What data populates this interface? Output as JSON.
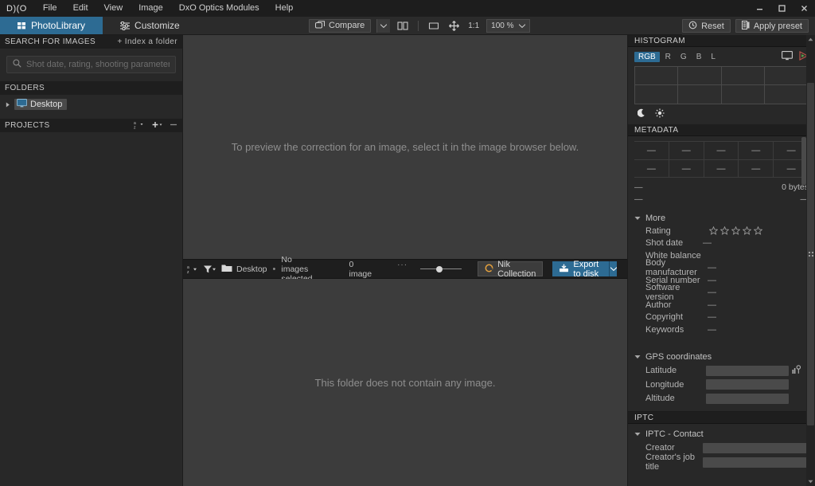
{
  "app": {
    "logo": "D)(O",
    "menus": [
      "File",
      "Edit",
      "View",
      "Image",
      "DxO Optics Modules",
      "Help"
    ],
    "window_controls": [
      "minimize",
      "maximize",
      "close"
    ],
    "accent_color": "#2d6b93"
  },
  "tabs": [
    {
      "label": "PhotoLibrary",
      "icon": "grid-icon",
      "active": true
    },
    {
      "label": "Customize",
      "icon": "sliders-icon",
      "active": false
    }
  ],
  "toolbar": {
    "compare_label": "Compare",
    "compare_icon": "compare-icon",
    "split_view_icon": "split-view-icon",
    "fit_icon": "fit-to-screen-icon",
    "pan_icon": "pan-icon",
    "ratio_label": "1:1",
    "zoom_value": "100 %",
    "reset_label": "Reset",
    "reset_icon": "history-icon",
    "apply_preset_label": "Apply preset",
    "apply_preset_icon": "preset-icon"
  },
  "sidebar": {
    "search": {
      "title": "SEARCH FOR IMAGES",
      "action": "+ Index a folder",
      "placeholder": "Shot date, rating, shooting parameters...",
      "value": ""
    },
    "folders": {
      "title": "FOLDERS",
      "items": [
        {
          "label": "Desktop",
          "selected": true
        }
      ]
    },
    "projects": {
      "title": "PROJECTS",
      "icons": [
        "sort-az-icon",
        "add-icon",
        "remove-icon"
      ]
    }
  },
  "viewer": {
    "message": "To preview the correction for an image, select it in the image browser below."
  },
  "browser_bar": {
    "sort_icon": "sort-az-icon",
    "filter_icon": "filter-icon",
    "folder_icon": "folder-icon",
    "folder_name": "Desktop",
    "separator": "•",
    "selection_status": "No images selected",
    "image_count": "0 image",
    "overflow": "···",
    "nik_label": "Nik Collection",
    "nik_icon": "nik-icon",
    "export_label": "Export to disk",
    "export_icon": "export-icon",
    "expand_icon": "chevron-right-icon"
  },
  "filmstrip": {
    "message": "This folder does not contain any image."
  },
  "histogram": {
    "title": "HISTOGRAM",
    "channels": [
      {
        "label": "RGB",
        "active": true
      },
      {
        "label": "R",
        "active": false
      },
      {
        "label": "G",
        "active": false
      },
      {
        "label": "B",
        "active": false
      },
      {
        "label": "L",
        "active": false
      }
    ],
    "right_icons": [
      "monitor-icon",
      "gamut-icon"
    ],
    "footer_icons": [
      "moon-icon",
      "sun-icon"
    ]
  },
  "metadata": {
    "title": "METADATA",
    "grid_row1": [
      "—",
      "—",
      "—",
      "—",
      "—"
    ],
    "grid_row2": [
      "—",
      "—",
      "—",
      "—",
      "—"
    ],
    "size_label": "—",
    "size_value": "0 bytes",
    "extra_label": "—",
    "extra_value": "—",
    "more": {
      "title": "More",
      "rating_label": "Rating",
      "rating_stars": 5,
      "rating_value": 0,
      "fields": [
        {
          "label": "Shot date",
          "value": "—"
        },
        {
          "label": "White balance",
          "value": ""
        },
        {
          "label": "Body manufacturer",
          "value": "—"
        },
        {
          "label": "Serial number",
          "value": "—"
        },
        {
          "label": "Software version",
          "value": "—"
        },
        {
          "label": "Author",
          "value": "—"
        },
        {
          "label": "Copyright",
          "value": "—"
        },
        {
          "label": "Keywords",
          "value": "—"
        }
      ]
    },
    "gps": {
      "title": "GPS coordinates",
      "map_icon": "map-pin-icon",
      "fields": [
        {
          "label": "Latitude",
          "value": ""
        },
        {
          "label": "Longitude",
          "value": ""
        },
        {
          "label": "Altitude",
          "value": ""
        }
      ]
    }
  },
  "iptc": {
    "title": "IPTC",
    "contact": {
      "title": "IPTC - Contact",
      "fields": [
        {
          "label": "Creator",
          "value": ""
        },
        {
          "label": "Creator's job title",
          "value": ""
        }
      ]
    }
  }
}
